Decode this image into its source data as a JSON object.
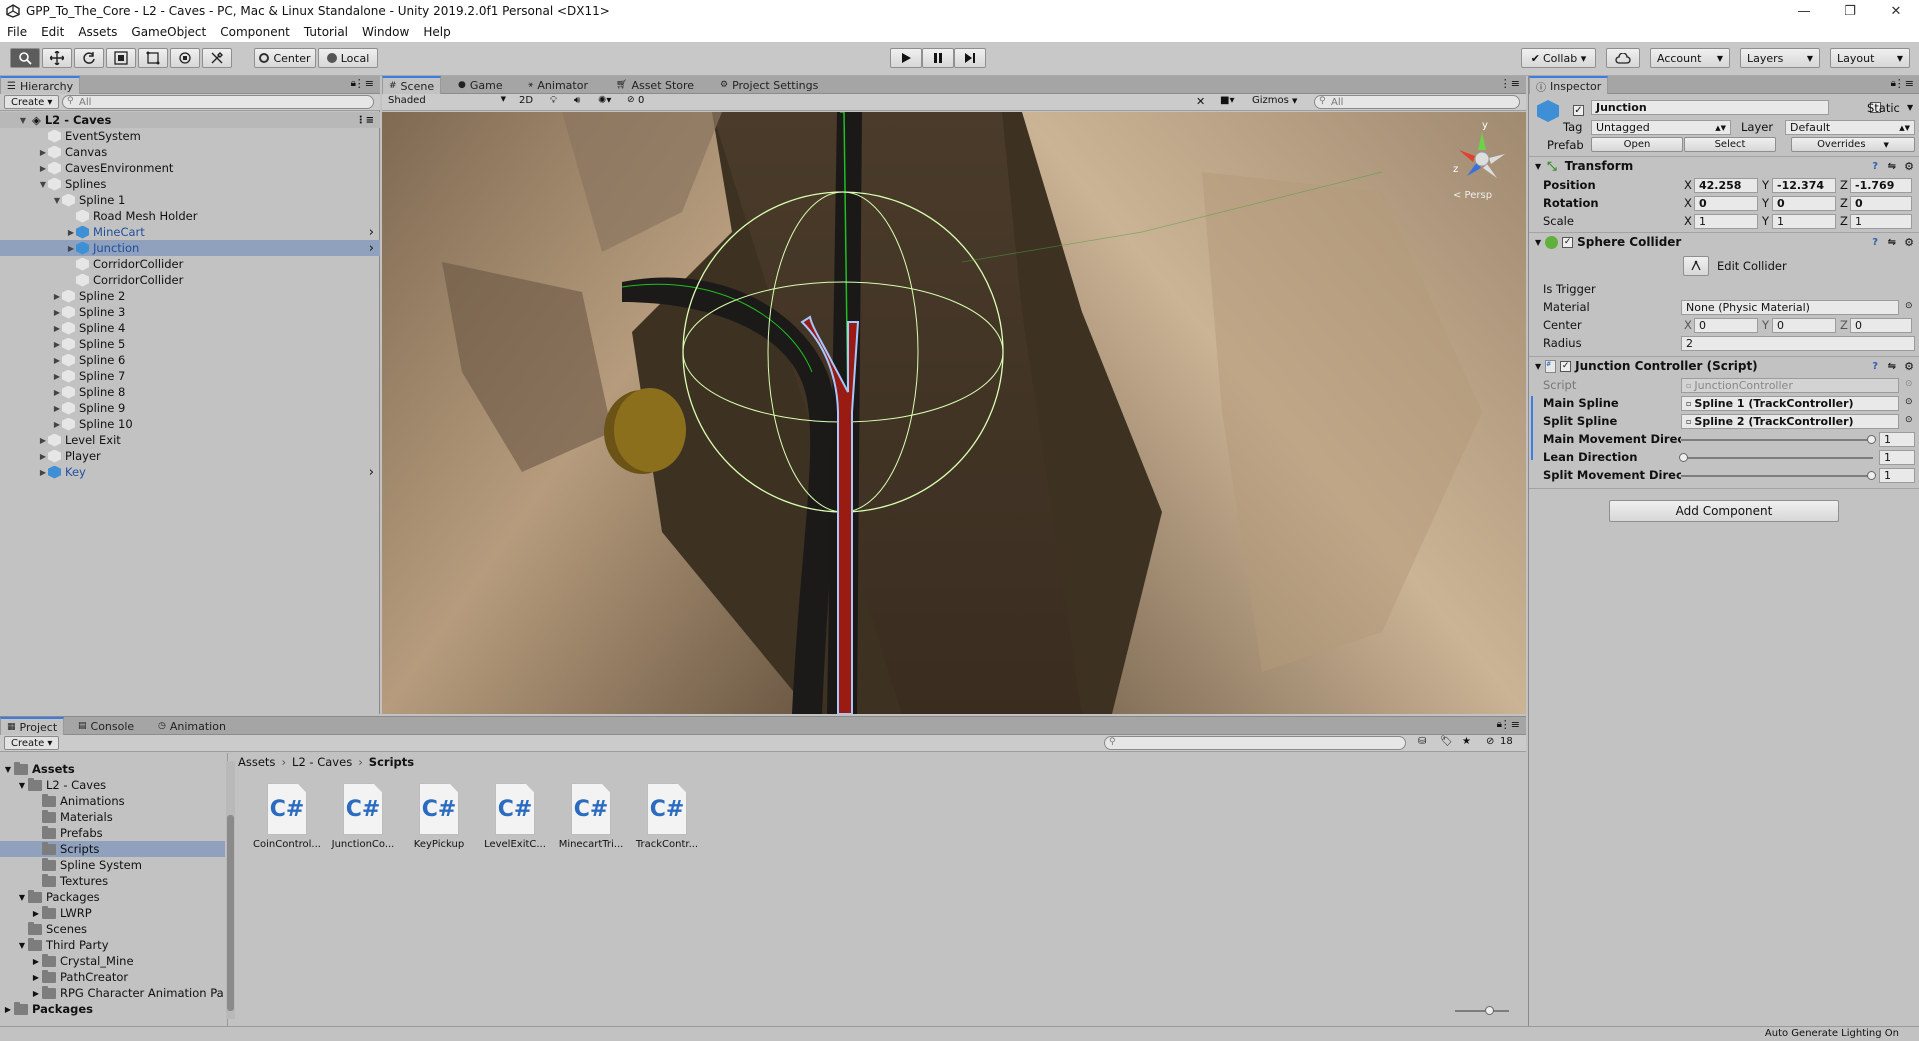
{
  "window": {
    "title": "GPP_To_The_Core - L2 - Caves - PC, Mac & Linux Standalone - Unity 2019.2.0f1 Personal <DX11>"
  },
  "menu": [
    "File",
    "Edit",
    "Assets",
    "GameObject",
    "Component",
    "Tutorial",
    "Window",
    "Help"
  ],
  "toolbar": {
    "pivot_center": "Center",
    "pivot_local": "Local",
    "collab": "Collab ▾",
    "account": "Account",
    "layers": "Layers",
    "layout": "Layout"
  },
  "hierarchy": {
    "tab": "Hierarchy",
    "create": "Create ▾",
    "search_placeholder": "All",
    "scene": "L2 - Caves",
    "items": [
      {
        "label": "EventSystem",
        "indent": 1,
        "arrow": ""
      },
      {
        "label": "Canvas",
        "indent": 1,
        "arrow": "▶"
      },
      {
        "label": "CavesEnvironment",
        "indent": 1,
        "arrow": "▶"
      },
      {
        "label": "Splines",
        "indent": 1,
        "arrow": "▼"
      },
      {
        "label": "Spline 1",
        "indent": 2,
        "arrow": "▼"
      },
      {
        "label": "Road Mesh Holder",
        "indent": 3,
        "arrow": ""
      },
      {
        "label": "MineCart",
        "indent": 3,
        "arrow": "▶",
        "prefab": true
      },
      {
        "label": "Junction",
        "indent": 3,
        "arrow": "▶",
        "prefab": true,
        "selected": true
      },
      {
        "label": "CorridorCollider",
        "indent": 3,
        "arrow": ""
      },
      {
        "label": "CorridorCollider",
        "indent": 3,
        "arrow": ""
      },
      {
        "label": "Spline 2",
        "indent": 2,
        "arrow": "▶"
      },
      {
        "label": "Spline 3",
        "indent": 2,
        "arrow": "▶"
      },
      {
        "label": "Spline 4",
        "indent": 2,
        "arrow": "▶"
      },
      {
        "label": "Spline 5",
        "indent": 2,
        "arrow": "▶"
      },
      {
        "label": "Spline 6",
        "indent": 2,
        "arrow": "▶"
      },
      {
        "label": "Spline 7",
        "indent": 2,
        "arrow": "▶"
      },
      {
        "label": "Spline 8",
        "indent": 2,
        "arrow": "▶"
      },
      {
        "label": "Spline 9",
        "indent": 2,
        "arrow": "▶"
      },
      {
        "label": "Spline 10",
        "indent": 2,
        "arrow": "▶"
      },
      {
        "label": "Level Exit",
        "indent": 1,
        "arrow": "▶"
      },
      {
        "label": "Player",
        "indent": 1,
        "arrow": "▶"
      },
      {
        "label": "Key",
        "indent": 1,
        "arrow": "▶",
        "prefab": true
      }
    ]
  },
  "scene_view": {
    "tabs": [
      "Scene",
      "Game",
      "Animator",
      "Asset Store",
      "Project Settings"
    ],
    "shading": "Shaded",
    "mode_2d": "2D",
    "fx_count": "0",
    "gizmos": "Gizmos",
    "search_placeholder": "All",
    "persp": "< Persp",
    "axis_y": "y",
    "axis_z": "z"
  },
  "inspector": {
    "tab": "Inspector",
    "object_name": "Junction",
    "static_label": "Static",
    "tag_label": "Tag",
    "tag_value": "Untagged",
    "layer_label": "Layer",
    "layer_value": "Default",
    "prefab_label": "Prefab",
    "prefab_open": "Open",
    "prefab_select": "Select",
    "prefab_overrides": "Overrides",
    "transform": {
      "title": "Transform",
      "position_label": "Position",
      "rotation_label": "Rotation",
      "scale_label": "Scale",
      "position": {
        "x": "42.258",
        "y": "-12.374",
        "z": "-1.769"
      },
      "rotation": {
        "x": "0",
        "y": "0",
        "z": "0"
      },
      "scale": {
        "x": "1",
        "y": "1",
        "z": "1"
      }
    },
    "sphere_collider": {
      "title": "Sphere Collider",
      "edit_collider": "Edit Collider",
      "is_trigger_label": "Is Trigger",
      "material_label": "Material",
      "material_value": "None (Physic Material)",
      "center_label": "Center",
      "center": {
        "x": "0",
        "y": "0",
        "z": "0"
      },
      "radius_label": "Radius",
      "radius": "2"
    },
    "junction_controller": {
      "title": "Junction Controller (Script)",
      "script_label": "Script",
      "script_value": "JunctionController",
      "main_spline_label": "Main Spline",
      "main_spline_value": "Spline 1 (TrackController)",
      "split_spline_label": "Split Spline",
      "split_spline_value": "Spline 2 (TrackController)",
      "main_movement_label": "Main Movement Direc",
      "main_movement_value": "1",
      "lean_direction_label": "Lean Direction",
      "lean_direction_value": "1",
      "split_movement_label": "Split Movement Direc",
      "split_movement_value": "1"
    },
    "add_component": "Add Component"
  },
  "project": {
    "tabs": [
      "Project",
      "Console",
      "Animation"
    ],
    "create": "Create ▾",
    "hidden_count": "18",
    "breadcrumb": [
      "Assets",
      "L2 - Caves",
      "Scripts"
    ],
    "tree": [
      {
        "label": "Assets",
        "indent": 0,
        "arrow": "▼",
        "bold": true
      },
      {
        "label": "L2 - Caves",
        "indent": 1,
        "arrow": "▼"
      },
      {
        "label": "Animations",
        "indent": 2,
        "arrow": ""
      },
      {
        "label": "Materials",
        "indent": 2,
        "arrow": ""
      },
      {
        "label": "Prefabs",
        "indent": 2,
        "arrow": ""
      },
      {
        "label": "Scripts",
        "indent": 2,
        "arrow": "",
        "selected": true
      },
      {
        "label": "Spline System",
        "indent": 2,
        "arrow": ""
      },
      {
        "label": "Textures",
        "indent": 2,
        "arrow": ""
      },
      {
        "label": "Packages",
        "indent": 1,
        "arrow": "▼"
      },
      {
        "label": "LWRP",
        "indent": 2,
        "arrow": "▶"
      },
      {
        "label": "Scenes",
        "indent": 1,
        "arrow": ""
      },
      {
        "label": "Third Party",
        "indent": 1,
        "arrow": "▼"
      },
      {
        "label": "Crystal_Mine",
        "indent": 2,
        "arrow": "▶"
      },
      {
        "label": "PathCreator",
        "indent": 2,
        "arrow": "▶"
      },
      {
        "label": "RPG Character Animation Pa",
        "indent": 2,
        "arrow": "▶"
      },
      {
        "label": "Packages",
        "indent": 0,
        "arrow": "▶",
        "bold": true
      }
    ],
    "assets": [
      {
        "label": "CoinControl...",
        "icon": "C#"
      },
      {
        "label": "JunctionCo...",
        "icon": "C#"
      },
      {
        "label": "KeyPickup",
        "icon": "C#"
      },
      {
        "label": "LevelExitC...",
        "icon": "C#"
      },
      {
        "label": "MinecartTri...",
        "icon": "C#"
      },
      {
        "label": "TrackContr...",
        "icon": "C#"
      }
    ]
  },
  "status": {
    "text": "Auto Generate Lighting On"
  }
}
